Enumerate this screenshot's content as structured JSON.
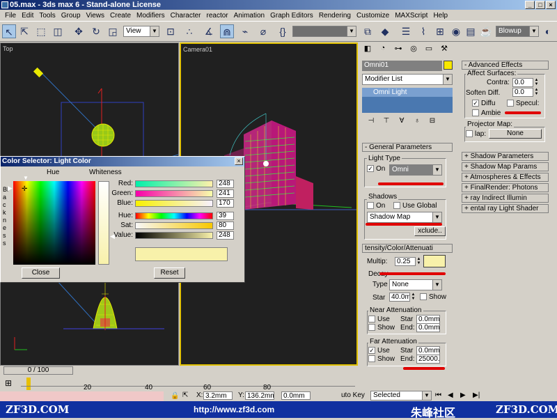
{
  "window": {
    "title": "05.max - 3ds max 6 - Stand-alone License"
  },
  "menu": [
    "File",
    "Edit",
    "Tools",
    "Group",
    "Views",
    "Create",
    "Modifiers",
    "Character",
    "reactor",
    "Animation",
    "Graph Editors",
    "Rendering",
    "Customize",
    "MAXScript",
    "Help"
  ],
  "toolbar": {
    "view_dropdown": "View",
    "blowup_dropdown": "Blowup"
  },
  "viewports": {
    "top_label": "Top",
    "camera_label": "Camera01"
  },
  "color_selector": {
    "title": "Color Selector: Light Color",
    "hue_label": "Hue",
    "whiteness_label": "Whiteness",
    "blackness_label": "Blackness",
    "red_label": "Red:",
    "red": "248",
    "green_label": "Green:",
    "green": "241",
    "blue_label": "Blue:",
    "blue": "170",
    "hue_field_label": "Hue:",
    "hue": "39",
    "sat_label": "Sat:",
    "sat": "80",
    "value_label": "Value:",
    "value": "248",
    "close": "Close",
    "reset": "Reset",
    "color": "#f8f1aa"
  },
  "command_panel": {
    "object_name": "Omni01",
    "object_color": "#f8e800",
    "modifier_list": "Modifier List",
    "stack_item": "Omni Light",
    "general_parameters": "General Parameters",
    "light_type_title": "Light Type",
    "light_on_label": "On",
    "light_type": "Omni",
    "shadows_title": "Shadows",
    "shadows_on_label": "On",
    "use_global_label": "Use Global",
    "shadow_type": "Shadow Map",
    "exclude_btn": "xclude..",
    "intensity_title": "tensity/Color/Attenuati",
    "multiplier_label": "Multip:",
    "multiplier": "0.25",
    "light_swatch": "#f8f1aa",
    "decay_label": "Decay",
    "type_label": "Type",
    "decay_type": "None",
    "start_label": "Star",
    "decay_start": "40.0m",
    "show_label": "Show",
    "near_attenuation_title": "Near Attenuation",
    "use_label": "Use",
    "start_short": "Star",
    "end_label": "End:",
    "near_start": "0.0mm",
    "near_end": "0.0mm",
    "far_attenuation_title": "Far Attenuation",
    "far_start": "0.0mm",
    "far_end": "25000.",
    "advanced_effects": "Advanced Effects",
    "affect_surfaces_title": "Affect Surfaces:",
    "contrast_label": "Contra:",
    "contrast": "0.0",
    "soften_label": "Soften Diff.",
    "soften": "0.0",
    "diffuse_label": "Diffu",
    "specular_label": "Specul:",
    "ambient_label": "Ambie",
    "projector_map_title": "Projector Map:",
    "map_label": "lap:",
    "map_value": "None",
    "rollouts": [
      "Shadow Parameters",
      "Shadow Map Params",
      "Atmospheres & Effects",
      "FinalRender: Photons",
      "ray Indirect Illumin",
      "ental ray Light Shader"
    ]
  },
  "timeline": {
    "position": "0 / 100",
    "ticks": [
      "20",
      "40",
      "60",
      "80"
    ]
  },
  "status": {
    "auto_key": "uto Key",
    "key_mode": "Selected",
    "x_label": "X:",
    "y_label": "Y:",
    "x_value": "3.2mm",
    "z_value": "0.0mm",
    "y_value": "136.2mm"
  },
  "footer": {
    "left_logo": "ZF3D.COM",
    "url": "http://www.zf3d.com",
    "community": "朱峰社区",
    "right_logo": "ZF3D.COM"
  }
}
